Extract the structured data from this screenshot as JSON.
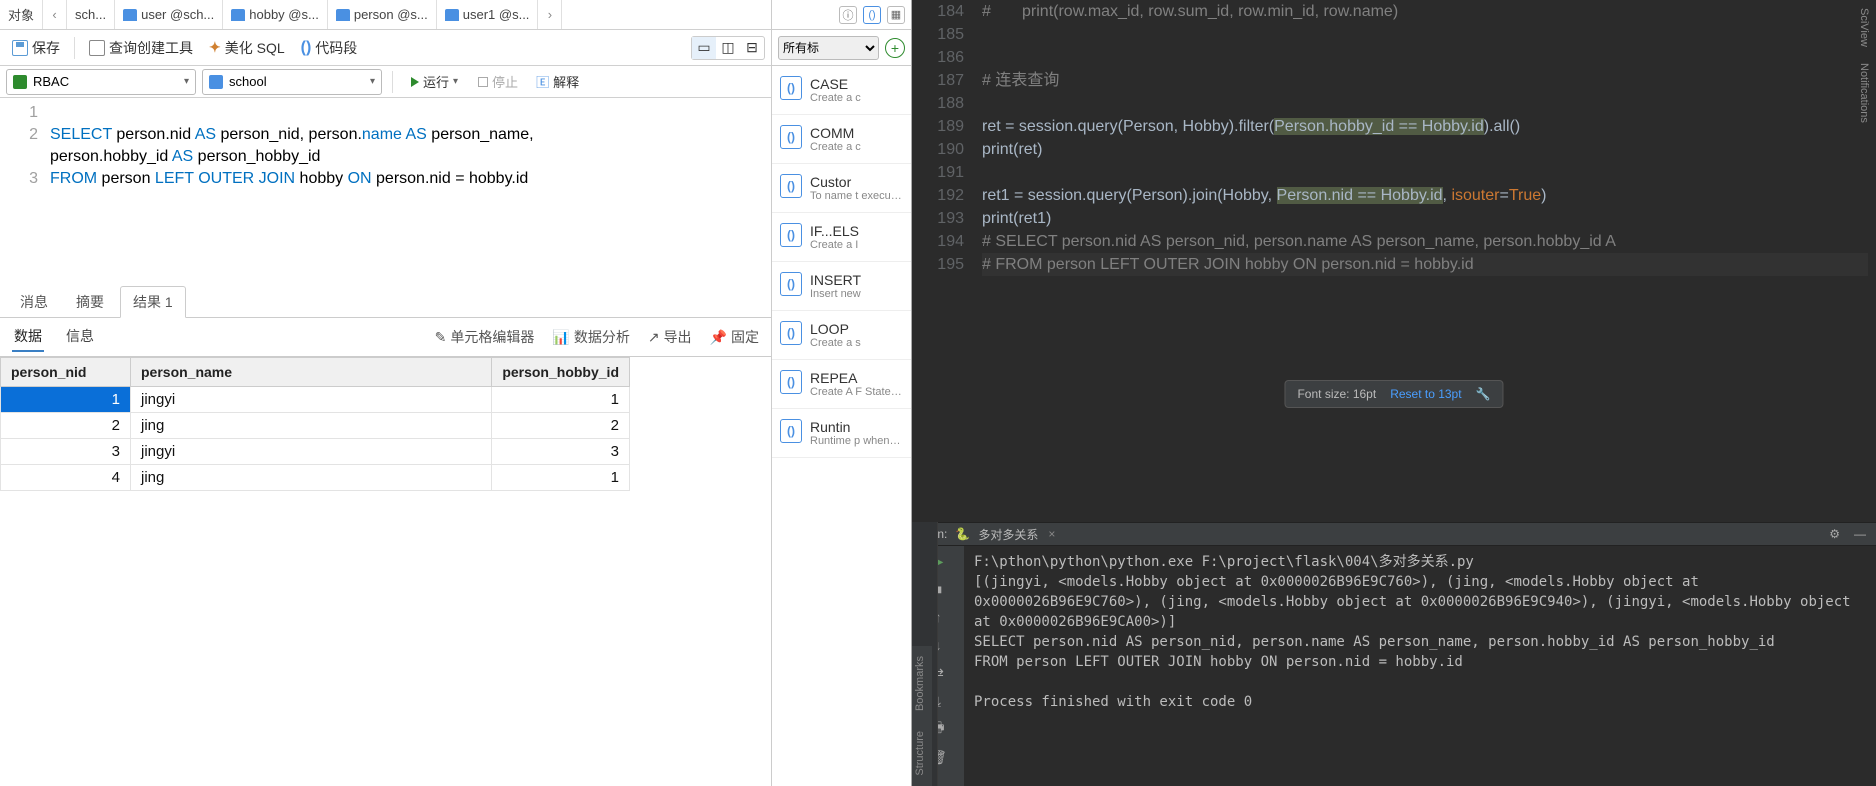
{
  "left": {
    "tabs": {
      "first": "对象",
      "items": [
        "sch...",
        "user @sch...",
        "hobby @s...",
        "person @s...",
        "user1 @s..."
      ]
    },
    "toolbar": {
      "save": "保存",
      "query_builder": "查询创建工具",
      "beautify": "美化 SQL",
      "snippet": "代码段"
    },
    "db": {
      "conn": "RBAC",
      "schema": "school",
      "run": "运行",
      "stop": "停止",
      "explain": "解释"
    },
    "sql": {
      "lines": [
        {
          "n": "1",
          "txt": ""
        },
        {
          "n": "2",
          "txt": "SELECT person.nid AS person_nid, person.name AS person_name, person.hobby_id AS person_hobby_id "
        },
        {
          "n": "3",
          "txt": "FROM person LEFT OUTER JOIN hobby ON person.nid = hobby.id"
        }
      ]
    },
    "res_tabs": {
      "msg": "消息",
      "summary": "摘要",
      "result": "结果 1"
    },
    "data_tb": {
      "data": "数据",
      "info": "信息",
      "cell": "单元格编辑器",
      "analyze": "数据分析",
      "export": "导出",
      "pin": "固定"
    },
    "grid": {
      "headers": [
        "person_nid",
        "person_name",
        "person_hobby_id"
      ],
      "rows": [
        {
          "nid": "1",
          "name": "jingyi",
          "hid": "1",
          "sel": true
        },
        {
          "nid": "2",
          "name": "jing",
          "hid": "2"
        },
        {
          "nid": "3",
          "name": "jingyi",
          "hid": "3"
        },
        {
          "nid": "4",
          "name": "jing",
          "hid": "1"
        }
      ]
    }
  },
  "mid": {
    "filter": "所有标",
    "templates": [
      {
        "name": "CASE",
        "desc": "Create a c"
      },
      {
        "name": "COMM",
        "desc": "Create a c"
      },
      {
        "name": "Custor",
        "desc": "To name t executing"
      },
      {
        "name": "IF...ELS",
        "desc": "Create a I"
      },
      {
        "name": "INSERT",
        "desc": "Insert new"
      },
      {
        "name": "LOOP",
        "desc": "Create a s"
      },
      {
        "name": "REPEA",
        "desc": "Create A F Statement search_co"
      },
      {
        "name": "Runtin",
        "desc": "Runtime p when the Navicat b you to inp"
      }
    ]
  },
  "right": {
    "code": [
      {
        "n": "184",
        "t": "#       print(row.max_id, row.sum_id, row.min_id, row.name)",
        "cm": true
      },
      {
        "n": "185",
        "t": ""
      },
      {
        "n": "186",
        "t": ""
      },
      {
        "n": "187",
        "t": "# 连表查询",
        "cm": true
      },
      {
        "n": "188",
        "t": ""
      },
      {
        "n": "189",
        "t": "ret = session.query(Person, Hobby).filter(|Person.hobby_id == Hobby.id|).all()"
      },
      {
        "n": "190",
        "t": "print(ret)"
      },
      {
        "n": "191",
        "t": ""
      },
      {
        "n": "192",
        "t": "ret1 = session.query(Person).join(Hobby, |Person.nid == Hobby.id|, isouter=True)"
      },
      {
        "n": "193",
        "t": "print(ret1)"
      },
      {
        "n": "194",
        "t": "# SELECT person.nid AS person_nid, person.name AS person_name, person.hobby_id A",
        "cm": true
      },
      {
        "n": "195",
        "t": "# FROM person LEFT OUTER JOIN hobby ON person.nid = hobby.id",
        "cm": true,
        "cur": true
      }
    ],
    "popup": {
      "size": "Font size: 16pt",
      "reset": "Reset to 13pt"
    },
    "run_bar": {
      "label": "Run:",
      "file": "多对多关系"
    },
    "console": [
      "F:\\pthon\\python\\python.exe F:\\project\\flask\\004\\多对多关系.py",
      "[(jingyi, <models.Hobby object at 0x0000026B96E9C760>), (jing, <models.Hobby object at 0x0000026B96E9C760>), (jing, <models.Hobby object at 0x0000026B96E9C940>), (jingyi, <models.Hobby object at 0x0000026B96E9CA00>)]",
      "SELECT person.nid AS person_nid, person.name AS person_name, person.hobby_id AS person_hobby_id ",
      "FROM person LEFT OUTER JOIN hobby ON person.nid = hobby.id",
      "",
      "Process finished with exit code 0"
    ],
    "side_tabs": [
      "SciView",
      "Notifications"
    ],
    "v_tabs": [
      "Bookmarks",
      "Structure"
    ]
  }
}
